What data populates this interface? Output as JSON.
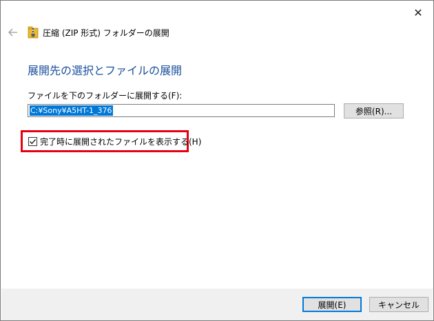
{
  "window": {
    "close_glyph": "✕",
    "back_glyph": "←"
  },
  "header": {
    "title": "圧縮 (ZIP 形式) フォルダーの展開"
  },
  "main": {
    "title": "展開先の選択とファイルの展開",
    "path_label": "ファイルを下のフォルダーに展開する(F):",
    "path_value": "C:¥Sony¥A5HT-1_376",
    "browse_label": "参照(R)...",
    "show_files_label": "完了時に展開されたファイルを表示する(H)",
    "show_files_checked": true
  },
  "footer": {
    "extract_label": "展開(E)",
    "cancel_label": "キャンセル"
  },
  "colors": {
    "title_blue": "#1a4f9c",
    "selection_blue": "#0078d7",
    "highlight_red": "#e60012",
    "footer_bg": "#f0f0f0"
  },
  "icons": {
    "zip_folder": "zip-folder-icon",
    "back": "back-arrow-icon",
    "close": "close-icon",
    "check": "checkmark-icon"
  }
}
